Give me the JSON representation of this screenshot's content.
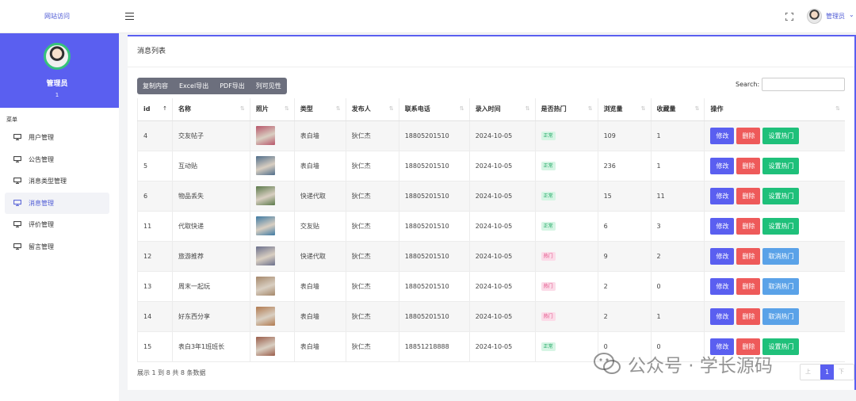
{
  "header": {
    "site_link": "网站访问",
    "user_name": "管理员",
    "user_caret": "⌄"
  },
  "sidebar": {
    "role": "管理员",
    "user_id": "1",
    "menu_heading": "菜单",
    "items": [
      {
        "label": "用户管理",
        "active": false
      },
      {
        "label": "公告管理",
        "active": false
      },
      {
        "label": "消息类型管理",
        "active": false
      },
      {
        "label": "消息管理",
        "active": true
      },
      {
        "label": "评价管理",
        "active": false
      },
      {
        "label": "留言管理",
        "active": false
      }
    ]
  },
  "panel": {
    "title": "消息列表",
    "toolbar": [
      "复制内容",
      "Excel导出",
      "PDF导出",
      "列可见性"
    ],
    "search_label": "Search:",
    "search_value": ""
  },
  "table": {
    "columns": [
      "id",
      "名称",
      "照片",
      "类型",
      "发布人",
      "联系电话",
      "录入时间",
      "是否热门",
      "浏览量",
      "收藏量",
      "操作"
    ],
    "sort_glyph": "⇅",
    "sort_active_glyph": "↑",
    "rows": [
      {
        "id": "4",
        "name": "交友帖子",
        "photo_color": "#b8556a",
        "type": "表白墙",
        "publisher": "狄仁杰",
        "phone": "18805201510",
        "date": "2024-10-05",
        "hot": "正常",
        "hot_kind": "normal",
        "views": "109",
        "favorites": "1",
        "action": "设置热门"
      },
      {
        "id": "5",
        "name": "互动贴",
        "photo_color": "#4f6d8a",
        "type": "表白墙",
        "publisher": "狄仁杰",
        "phone": "18805201510",
        "date": "2024-10-05",
        "hot": "正常",
        "hot_kind": "normal",
        "views": "236",
        "favorites": "1",
        "action": "设置热门"
      },
      {
        "id": "6",
        "name": "物品丢失",
        "photo_color": "#5b7a4a",
        "type": "快递代取",
        "publisher": "狄仁杰",
        "phone": "18805201510",
        "date": "2024-10-05",
        "hot": "正常",
        "hot_kind": "normal",
        "views": "15",
        "favorites": "11",
        "action": "设置热门"
      },
      {
        "id": "11",
        "name": "代取快递",
        "photo_color": "#3e7aa3",
        "type": "交友贴",
        "publisher": "狄仁杰",
        "phone": "18805201510",
        "date": "2024-10-05",
        "hot": "正常",
        "hot_kind": "normal",
        "views": "6",
        "favorites": "3",
        "action": "设置热门"
      },
      {
        "id": "12",
        "name": "旅游推荐",
        "photo_color": "#6a6f8c",
        "type": "快递代取",
        "publisher": "狄仁杰",
        "phone": "18805201510",
        "date": "2024-10-05",
        "hot": "热门",
        "hot_kind": "hot",
        "views": "9",
        "favorites": "2",
        "action": "取消热门"
      },
      {
        "id": "13",
        "name": "周末一起玩",
        "photo_color": "#a5876a",
        "type": "表白墙",
        "publisher": "狄仁杰",
        "phone": "18805201510",
        "date": "2024-10-05",
        "hot": "热门",
        "hot_kind": "hot",
        "views": "2",
        "favorites": "0",
        "action": "取消热门"
      },
      {
        "id": "14",
        "name": "好东西分享",
        "photo_color": "#b17a4f",
        "type": "表白墙",
        "publisher": "狄仁杰",
        "phone": "18805201510",
        "date": "2024-10-05",
        "hot": "热门",
        "hot_kind": "hot",
        "views": "2",
        "favorites": "1",
        "action": "取消热门"
      },
      {
        "id": "15",
        "name": "表白3年1班班长",
        "photo_color": "#9a5d4a",
        "type": "表白墙",
        "publisher": "狄仁杰",
        "phone": "18851218888",
        "date": "2024-10-05",
        "hot": "正常",
        "hot_kind": "normal",
        "views": "0",
        "favorites": "0",
        "action": "设置热门"
      }
    ],
    "edit_label": "修改",
    "delete_label": "删除"
  },
  "footer": {
    "summary": "展示 1 到 8 共 8 条数据",
    "prev": "上页",
    "page": "1",
    "next": "下页"
  },
  "watermark": "公众号 · 学长源码",
  "colors": {
    "accent": "#5a5ff0",
    "danger": "#ee5a5a",
    "success": "#1fc07a",
    "info": "#5aa2e8"
  }
}
